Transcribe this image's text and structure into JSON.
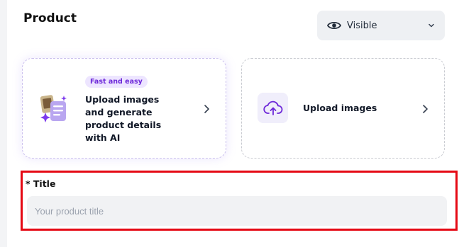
{
  "header": {
    "title": "Product"
  },
  "visibility": {
    "icon": "eye-icon",
    "value": "Visible",
    "chevron": "chevron-down-icon"
  },
  "cards": {
    "ai": {
      "badge": "Fast and easy",
      "title": "Upload images and generate product details with AI",
      "icon": "ai-sparkle-document-icon",
      "chevron": "chevron-right-icon"
    },
    "upload": {
      "label": "Upload images",
      "icon": "cloud-upload-icon",
      "chevron": "chevron-right-icon"
    }
  },
  "title_field": {
    "label": "* Title",
    "value": "",
    "placeholder": "Your product title"
  },
  "colors": {
    "accent": "#7c3aed",
    "badge_bg": "#ede5ff",
    "highlight": "#e50914",
    "input_bg": "#f1f2f4"
  }
}
